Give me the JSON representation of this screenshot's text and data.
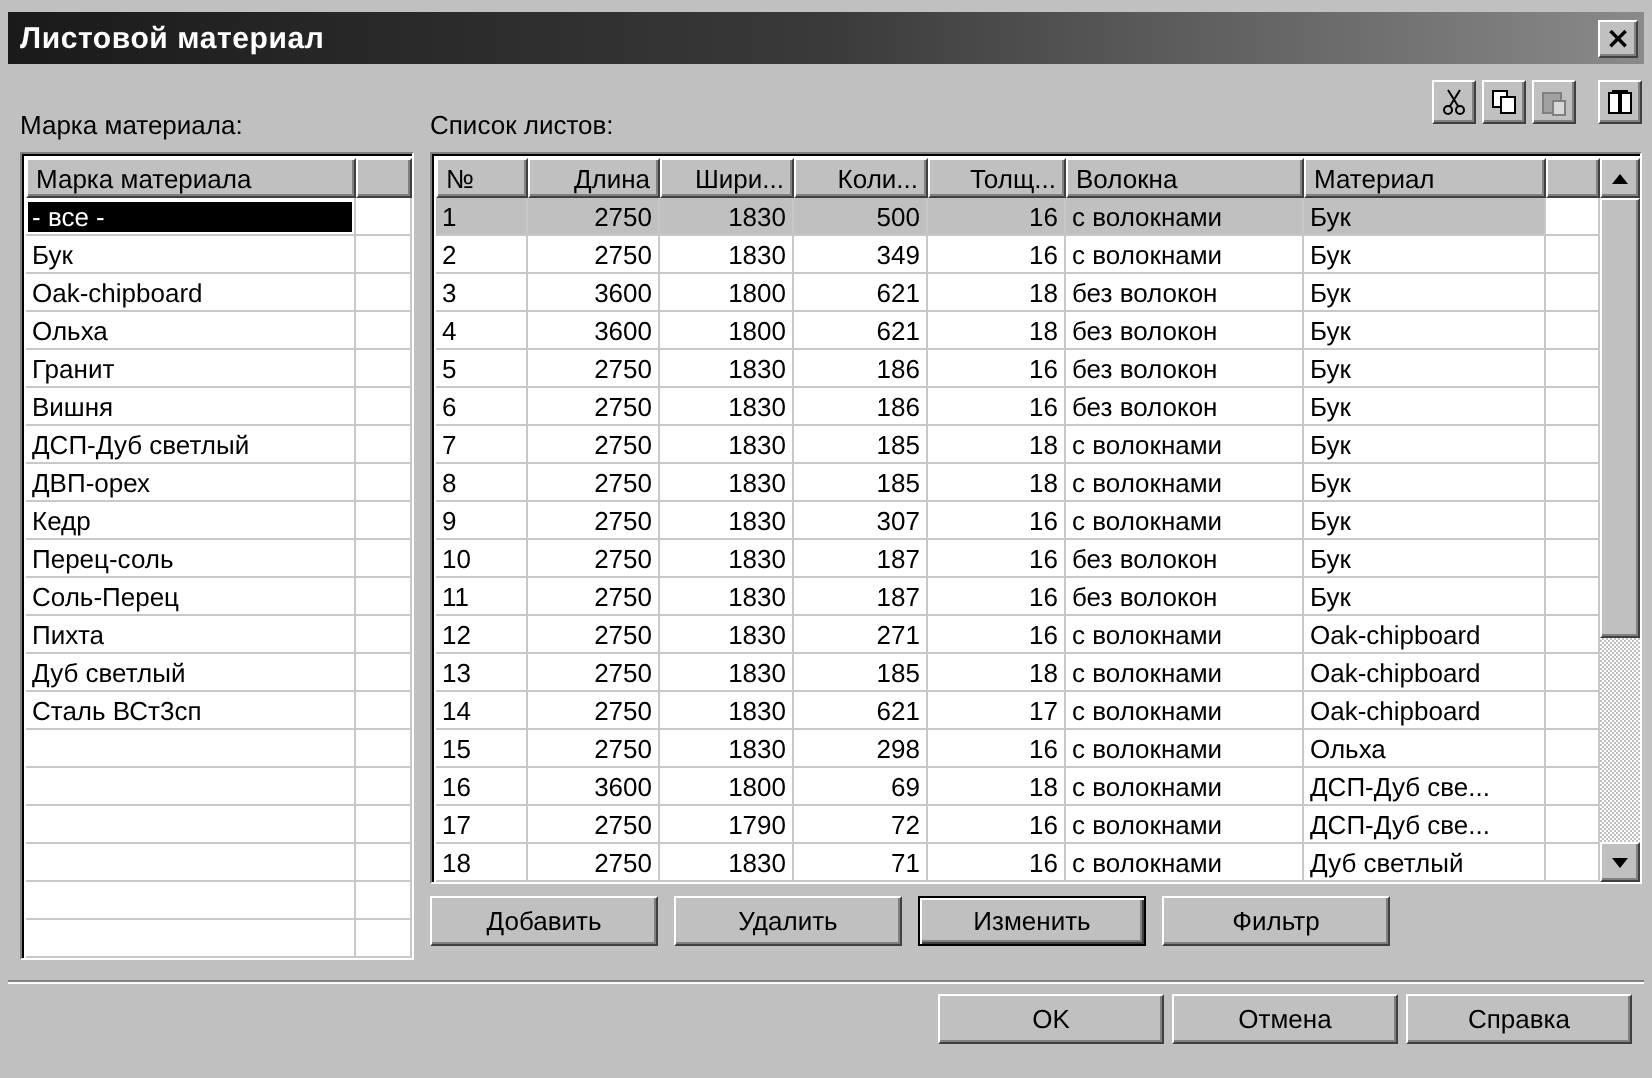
{
  "window": {
    "title": "Листовой материал",
    "close": "×"
  },
  "grades": {
    "label": "Марка материала:",
    "columns": [
      "Марка материала"
    ],
    "rows": [
      {
        "name": "- все -",
        "selected": true
      },
      {
        "name": "Бук",
        "selected": false
      },
      {
        "name": "Oak-chipboard",
        "selected": false
      },
      {
        "name": "Ольха",
        "selected": false
      },
      {
        "name": "Гранит",
        "selected": false
      },
      {
        "name": "Вишня",
        "selected": false
      },
      {
        "name": "ДСП-Дуб светлый",
        "selected": false
      },
      {
        "name": "ДВП-орех",
        "selected": false
      },
      {
        "name": "Кедр",
        "selected": false
      },
      {
        "name": "Перец-соль",
        "selected": false
      },
      {
        "name": "Соль-Перец",
        "selected": false
      },
      {
        "name": "Пихта",
        "selected": false
      },
      {
        "name": "Дуб светлый",
        "selected": false
      },
      {
        "name": "Сталь ВСт3сп",
        "selected": false
      }
    ]
  },
  "sheets": {
    "label": "Список листов:",
    "toolbar": [
      {
        "kind": "cut",
        "disabled": false
      },
      {
        "kind": "copy",
        "disabled": false
      },
      {
        "kind": "paste",
        "disabled": true
      },
      {
        "kind": "book",
        "disabled": false
      }
    ],
    "columns": [
      "№",
      "Длина",
      "Шири...",
      "Коли...",
      "Толщ...",
      "Волокна",
      "Материал"
    ],
    "rows": [
      {
        "cells": [
          "1",
          "2750",
          "1830",
          "500",
          "16",
          "с волокнами",
          "Бук"
        ],
        "selected": true
      },
      {
        "cells": [
          "2",
          "2750",
          "1830",
          "349",
          "16",
          "с волокнами",
          "Бук"
        ],
        "selected": false
      },
      {
        "cells": [
          "3",
          "3600",
          "1800",
          "621",
          "18",
          "без волокон",
          "Бук"
        ],
        "selected": false
      },
      {
        "cells": [
          "4",
          "3600",
          "1800",
          "621",
          "18",
          "без волокон",
          "Бук"
        ],
        "selected": false
      },
      {
        "cells": [
          "5",
          "2750",
          "1830",
          "186",
          "16",
          "без волокон",
          "Бук"
        ],
        "selected": false
      },
      {
        "cells": [
          "6",
          "2750",
          "1830",
          "186",
          "16",
          "без волокон",
          "Бук"
        ],
        "selected": false
      },
      {
        "cells": [
          "7",
          "2750",
          "1830",
          "185",
          "18",
          "с волокнами",
          "Бук"
        ],
        "selected": false
      },
      {
        "cells": [
          "8",
          "2750",
          "1830",
          "185",
          "18",
          "с волокнами",
          "Бук"
        ],
        "selected": false
      },
      {
        "cells": [
          "9",
          "2750",
          "1830",
          "307",
          "16",
          "с волокнами",
          "Бук"
        ],
        "selected": false
      },
      {
        "cells": [
          "10",
          "2750",
          "1830",
          "187",
          "16",
          "без волокон",
          "Бук"
        ],
        "selected": false
      },
      {
        "cells": [
          "11",
          "2750",
          "1830",
          "187",
          "16",
          "без волокон",
          "Бук"
        ],
        "selected": false
      },
      {
        "cells": [
          "12",
          "2750",
          "1830",
          "271",
          "16",
          "с волокнами",
          "Oak-chipboard"
        ],
        "selected": false
      },
      {
        "cells": [
          "13",
          "2750",
          "1830",
          "185",
          "18",
          "с волокнами",
          "Oak-chipboard"
        ],
        "selected": false
      },
      {
        "cells": [
          "14",
          "2750",
          "1830",
          "621",
          "17",
          "с волокнами",
          "Oak-chipboard"
        ],
        "selected": false
      },
      {
        "cells": [
          "15",
          "2750",
          "1830",
          "298",
          "16",
          "с волокнами",
          "Ольха"
        ],
        "selected": false
      },
      {
        "cells": [
          "16",
          "3600",
          "1800",
          "69",
          "18",
          "с волокнами",
          "ДСП-Дуб све..."
        ],
        "selected": false
      },
      {
        "cells": [
          "17",
          "2750",
          "1790",
          "72",
          "16",
          "с волокнами",
          "ДСП-Дуб све..."
        ],
        "selected": false
      },
      {
        "cells": [
          "18",
          "2750",
          "1830",
          "71",
          "16",
          "с волокнами",
          "Дуб светлый"
        ],
        "selected": false
      }
    ],
    "buttons": [
      {
        "label": "Добавить",
        "default": false
      },
      {
        "label": "Удалить",
        "default": false
      },
      {
        "label": "Изменить",
        "default": true
      },
      {
        "label": "Фильтр",
        "default": false
      }
    ]
  },
  "footer_buttons": [
    {
      "label": "OK",
      "default": false
    },
    {
      "label": "Отмена",
      "default": false
    },
    {
      "label": "Справка",
      "default": false
    }
  ]
}
